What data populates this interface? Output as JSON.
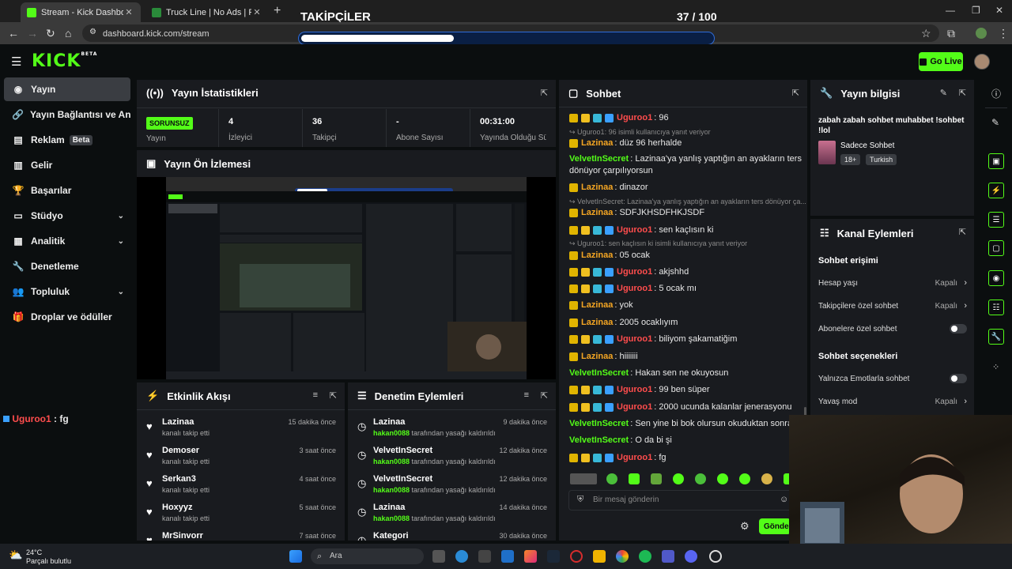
{
  "browser": {
    "tabs": [
      {
        "title": "Stream - Kick Dashboard",
        "active": true
      },
      {
        "title": "Truck Line | No Ads | Play At Fri",
        "active": false
      }
    ],
    "url": "dashboard.kick.com/stream"
  },
  "overlay": {
    "title": "TAKİPÇİLER",
    "count": "37 / 100",
    "progress": 0.37
  },
  "header": {
    "logo": "KICK",
    "logo_sup": "BETA",
    "go_live": "Go Live"
  },
  "sidebar": {
    "items": [
      {
        "label": "Yayın",
        "icon": "broadcast-icon"
      },
      {
        "label": "Yayın Bağlantısı ve Anahtarı",
        "icon": "link-icon"
      },
      {
        "label": "Reklam",
        "icon": "ad-icon",
        "badge": "Beta"
      },
      {
        "label": "Gelir",
        "icon": "chart-icon"
      },
      {
        "label": "Başarılar",
        "icon": "trophy-icon"
      },
      {
        "label": "Stüdyo",
        "icon": "studio-icon"
      },
      {
        "label": "Analitik",
        "icon": "analytics-icon"
      },
      {
        "label": "Denetleme",
        "icon": "wrench-icon"
      },
      {
        "label": "Topluluk",
        "icon": "community-icon"
      },
      {
        "label": "Droplar ve ödüller",
        "icon": "gift-icon"
      }
    ],
    "chat_user": "Uguroo1",
    "chat_text": " : fg"
  },
  "stats": {
    "title": "Yayın İstatistikleri",
    "status": "SORUNSUZ",
    "status_label": "Yayın",
    "cells": [
      {
        "value": "4",
        "label": "İzleyici"
      },
      {
        "value": "36",
        "label": "Takipçi"
      },
      {
        "value": "-",
        "label": "Abone Sayısı"
      },
      {
        "value": "00:31:00",
        "label": "Yayında Olduğu Süre"
      }
    ]
  },
  "preview": {
    "title": "Yayın Ön İzlemesi"
  },
  "activity": {
    "title": "Etkinlik Akışı",
    "rows": [
      {
        "name": "Lazinaa",
        "sub": "kanalı takip etti",
        "time": "15 dakika önce"
      },
      {
        "name": "Demoser",
        "sub": "kanalı takip etti",
        "time": "3 saat önce"
      },
      {
        "name": "Serkan3",
        "sub": "kanalı takip etti",
        "time": "4 saat önce"
      },
      {
        "name": "Hoxyyz",
        "sub": "kanalı takip etti",
        "time": "5 saat önce"
      },
      {
        "name": "MrSinvorr",
        "sub": "",
        "time": "7 saat önce"
      }
    ]
  },
  "moderation": {
    "title": "Denetim Eylemleri",
    "rows": [
      {
        "name": "Lazinaa",
        "by": "hakan0088",
        "sub": " tarafından yasağı kaldırıldı",
        "time": "9 dakika önce"
      },
      {
        "name": "VelvetInSecret",
        "by": "hakan0088",
        "sub": " tarafından yasağı kaldırıldı",
        "time": "12 dakika önce"
      },
      {
        "name": "VelvetInSecret",
        "by": "hakan0088",
        "sub": " tarafından yasağı kaldırıldı",
        "time": "12 dakika önce"
      },
      {
        "name": "Lazinaa",
        "by": "hakan0088",
        "sub": " tarafından yasağı kaldırıldı",
        "time": "14 dakika önce"
      },
      {
        "name": "Kategori",
        "by": "",
        "sub": "",
        "time": "30 dakika önce"
      }
    ]
  },
  "chat": {
    "title": "Sohbet",
    "messages": [
      {
        "type": "msg",
        "user": "Uguroo1",
        "color": "#ff4d4d",
        "badges": true,
        "text": ": 96"
      },
      {
        "type": "reply",
        "text": "↪ Uguroo1: 96 isimli kullanıcıya yanıt veriyor"
      },
      {
        "type": "msg",
        "user": "Lazinaa",
        "color": "#f5a623",
        "badges": false,
        "text": ": düz 96 herhalde"
      },
      {
        "type": "msg",
        "user": "VelvetInSecret",
        "color": "#53fc18",
        "badges": false,
        "text": ": Lazinaa'ya yanlış yaptığın an ayakların ters"
      },
      {
        "type": "cont",
        "text": "dönüyor çarpılıyorsun"
      },
      {
        "type": "msg",
        "user": "Lazinaa",
        "color": "#f5a623",
        "badges": false,
        "text": ": dinazor"
      },
      {
        "type": "reply",
        "text": "↪ VelvetInSecret: Lazinaa'ya yanlış yaptığın an ayakların ters dönüyor ça..."
      },
      {
        "type": "msg",
        "user": "Lazinaa",
        "color": "#f5a623",
        "badges": false,
        "text": ": SDFJKHSDFHKJSDF"
      },
      {
        "type": "msg",
        "user": "Uguroo1",
        "color": "#ff4d4d",
        "badges": true,
        "text": ": sen kaçlısın ki"
      },
      {
        "type": "reply",
        "text": "↪ Uguroo1: sen kaçlısın ki isimli kullanıcıya yanıt veriyor"
      },
      {
        "type": "msg",
        "user": "Lazinaa",
        "color": "#f5a623",
        "badges": false,
        "text": ": 05 ocak"
      },
      {
        "type": "msg",
        "user": "Uguroo1",
        "color": "#ff4d4d",
        "badges": true,
        "text": ": akjshhd"
      },
      {
        "type": "msg",
        "user": "Uguroo1",
        "color": "#ff4d4d",
        "badges": true,
        "text": ": 5 ocak mı"
      },
      {
        "type": "msg",
        "user": "Lazinaa",
        "color": "#f5a623",
        "badges": false,
        "text": ": yok"
      },
      {
        "type": "msg",
        "user": "Lazinaa",
        "color": "#f5a623",
        "badges": false,
        "text": ": 2005 ocaklıyım"
      },
      {
        "type": "msg",
        "user": "Uguroo1",
        "color": "#ff4d4d",
        "badges": true,
        "text": ": biliyom şakamatiğim"
      },
      {
        "type": "msg",
        "user": "Lazinaa",
        "color": "#f5a623",
        "badges": false,
        "text": ": hiiiiiii"
      },
      {
        "type": "msg",
        "user": "VelvetInSecret",
        "color": "#53fc18",
        "badges": false,
        "text": ": Hakan sen ne okuyosun"
      },
      {
        "type": "msg",
        "user": "Uguroo1",
        "color": "#ff4d4d",
        "badges": true,
        "text": ": 99 ben süper"
      },
      {
        "type": "msg",
        "user": "Uguroo1",
        "color": "#ff4d4d",
        "badges": true,
        "text": ": 2000 ucunda kalanlar jenerasyonu"
      },
      {
        "type": "msg",
        "user": "VelvetInSecret",
        "color": "#53fc18",
        "badges": false,
        "text": ": Sen yine bi bok olursun okuduktan sonra"
      },
      {
        "type": "msg",
        "user": "VelvetInSecret",
        "color": "#53fc18",
        "badges": false,
        "text": ": O da bi şi"
      },
      {
        "type": "msg",
        "user": "Uguroo1",
        "color": "#ff4d4d",
        "badges": true,
        "text": ": fg"
      }
    ],
    "input_placeholder": "Bir mesaj gönderin",
    "send_label": "Gönder"
  },
  "stream_info": {
    "title": "Yayın bilgisi",
    "stream_title": "zabah zabah sohbet muhabbet !sohbet !lol",
    "category": "Sadece Sohbet",
    "tags": [
      "18+",
      "Turkish"
    ]
  },
  "channel_actions": {
    "title": "Kanal Eylemleri",
    "access_heading": "Sohbet erişimi",
    "access_rows": [
      {
        "label": "Hesap yaşı",
        "value": "Kapalı",
        "kind": "select"
      },
      {
        "label": "Takipçilere özel sohbet",
        "value": "Kapalı",
        "kind": "select"
      },
      {
        "label": "Abonelere özel sohbet",
        "value": "",
        "kind": "toggle"
      }
    ],
    "options_heading": "Sohbet seçenekleri",
    "option_rows": [
      {
        "label": "Yalnızca Emotlarla sohbet",
        "value": "",
        "kind": "toggle"
      },
      {
        "label": "Yavaş mod",
        "value": "Kapalı",
        "kind": "select"
      }
    ]
  },
  "taskbar": {
    "temp": "24°C",
    "weather": "Parçalı bulutlu",
    "search": "Ara"
  },
  "colors": {
    "accent": "#53fc18",
    "panel": "#191b1f",
    "bg": "#0b0e0f"
  }
}
